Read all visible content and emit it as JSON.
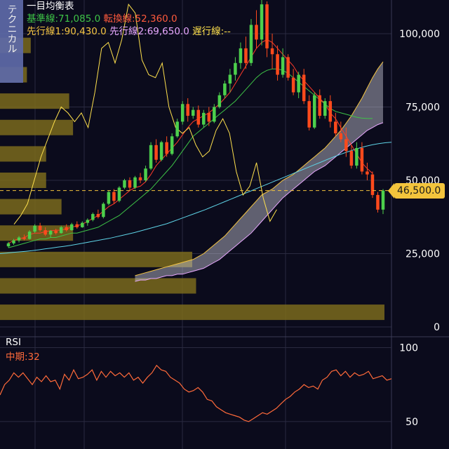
{
  "sidebar_tab": {
    "label": "テクニカル"
  },
  "legend": {
    "title": "一目均衡表",
    "kijun": "基準線:71,085.0",
    "tenkan": "転換線:52,360.0",
    "span1": "先行線1:90,430.0",
    "span2": "先行線2:69,650.0",
    "chikou": "遅行線:--"
  },
  "price_label": "46,500.0",
  "rsi": {
    "title": "RSI",
    "mid": "中期:32"
  },
  "colors": {
    "background": "#0b0b1c",
    "up": "#4cd04c",
    "down": "#ff4a1c",
    "kijun": "#3ec447",
    "tenkan": "#ff3a2a",
    "span1": "#f5c542",
    "span2": "#e9a8ff",
    "chikou": "#ffe14d",
    "sma": "#5ed3e6",
    "rsi": "#ff6a3a",
    "volume_profile": "#7a6a1c"
  },
  "chart_data": [
    {
      "type": "candlestick",
      "title": "一目均衡表",
      "ylim": [
        0,
        112000
      ],
      "y_ticks": [
        {
          "value": 0,
          "label": "0"
        },
        {
          "value": 25000,
          "label": "25,000"
        },
        {
          "value": 50000,
          "label": "50,000"
        },
        {
          "value": 75000,
          "label": "75,000"
        },
        {
          "value": 100000,
          "label": "100,000"
        }
      ],
      "current_price": 46500,
      "grid": true,
      "candles": [
        [
          27500,
          29000,
          27000,
          28500
        ],
        [
          28500,
          30000,
          28000,
          29500
        ],
        [
          29500,
          31000,
          28800,
          30500
        ],
        [
          30500,
          31500,
          29500,
          30000
        ],
        [
          30000,
          33000,
          29800,
          32500
        ],
        [
          32500,
          35000,
          32000,
          34500
        ],
        [
          34500,
          35500,
          32500,
          33000
        ],
        [
          33000,
          34000,
          31000,
          31500
        ],
        [
          31500,
          33000,
          30500,
          32800
        ],
        [
          32800,
          33500,
          31500,
          32000
        ],
        [
          32000,
          34500,
          31800,
          34000
        ],
        [
          34000,
          35000,
          32500,
          33000
        ],
        [
          33000,
          35500,
          32800,
          35000
        ],
        [
          35000,
          36000,
          33500,
          34000
        ],
        [
          34000,
          36000,
          33800,
          35500
        ],
        [
          35500,
          37000,
          34500,
          36500
        ],
        [
          36500,
          39000,
          36000,
          38500
        ],
        [
          38500,
          40000,
          37000,
          37500
        ],
        [
          37500,
          42500,
          37000,
          42000
        ],
        [
          42000,
          46500,
          41500,
          46000
        ],
        [
          46000,
          47000,
          42000,
          43000
        ],
        [
          43000,
          48000,
          42500,
          47500
        ],
        [
          47500,
          50500,
          47000,
          50000
        ],
        [
          50000,
          51000,
          46500,
          47500
        ],
        [
          47500,
          51500,
          47000,
          51000
        ],
        [
          51000,
          52500,
          49000,
          50000
        ],
        [
          50000,
          55000,
          49500,
          54000
        ],
        [
          54000,
          63000,
          53500,
          62000
        ],
        [
          62000,
          64000,
          56000,
          57000
        ],
        [
          57000,
          63500,
          56500,
          63000
        ],
        [
          63000,
          65000,
          58000,
          59000
        ],
        [
          59000,
          66000,
          58500,
          65000
        ],
        [
          65000,
          71000,
          64500,
          70000
        ],
        [
          70000,
          77000,
          69000,
          76000
        ],
        [
          76000,
          78000,
          70000,
          72000
        ],
        [
          72000,
          75000,
          71000,
          74000
        ],
        [
          74000,
          75500,
          68000,
          69000
        ],
        [
          69000,
          74000,
          68000,
          73000
        ],
        [
          73000,
          75000,
          68500,
          70000
        ],
        [
          70000,
          76000,
          69500,
          75000
        ],
        [
          75000,
          80000,
          74500,
          79000
        ],
        [
          79000,
          84000,
          78000,
          83000
        ],
        [
          83000,
          88000,
          80000,
          86000
        ],
        [
          86000,
          92000,
          84000,
          90000
        ],
        [
          90000,
          97000,
          88000,
          95000
        ],
        [
          95000,
          99000,
          88000,
          90000
        ],
        [
          90000,
          105000,
          89000,
          103000
        ],
        [
          103000,
          108000,
          95000,
          98000
        ],
        [
          98000,
          112000,
          96000,
          110000
        ],
        [
          110000,
          111000,
          92000,
          95000
        ],
        [
          95000,
          100000,
          88000,
          93000
        ],
        [
          93000,
          96000,
          84000,
          86000
        ],
        [
          86000,
          95000,
          85000,
          92000
        ],
        [
          92000,
          93000,
          84000,
          85000
        ],
        [
          85000,
          88000,
          79000,
          80000
        ],
        [
          80000,
          87000,
          78000,
          86000
        ],
        [
          86000,
          88000,
          76000,
          77000
        ],
        [
          77000,
          79000,
          67000,
          68000
        ],
        [
          68000,
          80000,
          67500,
          79000
        ],
        [
          79000,
          81000,
          71000,
          72000
        ],
        [
          72000,
          78000,
          71000,
          77000
        ],
        [
          77000,
          79000,
          68000,
          70000
        ],
        [
          70000,
          73000,
          65000,
          66000
        ],
        [
          66000,
          70000,
          63000,
          64000
        ],
        [
          64000,
          68000,
          58000,
          60000
        ],
        [
          60000,
          62000,
          54000,
          55000
        ],
        [
          55000,
          63000,
          54000,
          61000
        ],
        [
          61000,
          63000,
          52000,
          53000
        ],
        [
          53000,
          56000,
          50000,
          52000
        ],
        [
          52000,
          53000,
          44000,
          45000
        ],
        [
          45000,
          46000,
          39000,
          40000
        ],
        [
          40000,
          47000,
          38500,
          46500
        ]
      ],
      "tenkan": [
        28500,
        29500,
        30000,
        30500,
        31500,
        32000,
        32000,
        32500,
        32800,
        33000,
        33000,
        33500,
        34000,
        34500,
        35000,
        36000,
        37000,
        38000,
        39500,
        41000,
        42000,
        43500,
        45000,
        46500,
        47500,
        48000,
        49500,
        52000,
        55000,
        57000,
        59000,
        61000,
        63000,
        65500,
        68000,
        70000,
        71000,
        72000,
        73000,
        74500,
        76000,
        78000,
        80000,
        83000,
        86000,
        89000,
        92000,
        95000,
        97000,
        98000,
        97000,
        95000,
        93000,
        91000,
        89000,
        86000,
        84000,
        82000,
        80000,
        78000,
        76000,
        73000,
        71000,
        68000,
        65000,
        62000,
        59000,
        56000,
        54000,
        52360
      ],
      "kijun": [
        27000,
        27500,
        28000,
        28500,
        29000,
        29500,
        30000,
        30000,
        30500,
        30500,
        31000,
        31500,
        32000,
        32000,
        32500,
        33000,
        33500,
        34000,
        35000,
        36000,
        37000,
        38000,
        39500,
        41000,
        42500,
        44000,
        45500,
        47000,
        49000,
        51000,
        53000,
        55000,
        57500,
        60000,
        62500,
        65000,
        66500,
        68000,
        69500,
        71000,
        72500,
        74000,
        75500,
        77000,
        79000,
        81000,
        83000,
        85000,
        86500,
        87500,
        88000,
        88000,
        87500,
        86500,
        85000,
        83500,
        82000,
        80500,
        79000,
        77500,
        76000,
        74500,
        73500,
        73000,
        72500,
        72000,
        71500,
        71200,
        71085,
        71085
      ],
      "span1": [
        17500,
        18000,
        18500,
        19000,
        19500,
        20000,
        20500,
        21000,
        21500,
        22000,
        22500,
        23000,
        24000,
        25000,
        26500,
        28000,
        29500,
        31000,
        33000,
        35000,
        37000,
        39000,
        41000,
        43000,
        45000,
        46000,
        47000,
        48500,
        50000,
        51000,
        52000,
        53500,
        55000,
        56500,
        58000,
        59500,
        61000,
        63000,
        65000,
        67000,
        69500,
        72000,
        75000,
        78000,
        81500,
        85000,
        88000,
        90430
      ],
      "span2": [
        15500,
        16000,
        16000,
        16500,
        16500,
        17000,
        17500,
        17500,
        18000,
        18000,
        18500,
        19000,
        19500,
        20000,
        21000,
        22000,
        23000,
        24500,
        26000,
        27500,
        29000,
        30500,
        32000,
        34000,
        36000,
        38000,
        40000,
        42000,
        44000,
        45500,
        47000,
        48500,
        50000,
        51500,
        53000,
        54000,
        55000,
        56500,
        58000,
        59500,
        61000,
        62500,
        64000,
        65500,
        67000,
        68000,
        69000,
        69650
      ],
      "chikou": [
        35000,
        38000,
        42000,
        50000,
        58000,
        64000,
        70000,
        75000,
        73000,
        70000,
        73000,
        68000,
        80000,
        95000,
        97000,
        90000,
        98000,
        110000,
        107000,
        91000,
        86000,
        85000,
        90000,
        75000,
        68000,
        66000,
        68000,
        62000,
        58000,
        60000,
        67000,
        71000,
        66000,
        53000,
        45000,
        48000,
        56000,
        44000,
        36000,
        40000
      ],
      "sma": [
        25000,
        25200,
        25400,
        25600,
        25800,
        26000,
        26300,
        26600,
        26900,
        27200,
        27500,
        27800,
        28200,
        28600,
        29000,
        29400,
        29800,
        30200,
        30700,
        31200,
        31700,
        32200,
        32800,
        33400,
        34000,
        34600,
        35200,
        36000,
        36800,
        37600,
        38400,
        39200,
        40000,
        40900,
        41800,
        42700,
        43600,
        44500,
        45400,
        46300,
        47200,
        48100,
        49000,
        49900,
        50800,
        51700,
        52600,
        53500,
        54400,
        55300,
        56200,
        57100,
        58000,
        58800,
        59600,
        60300,
        61000,
        61600,
        62100,
        62500,
        62800,
        63000
      ],
      "volume_profile": [
        {
          "price": 96000,
          "strength": 0.08
        },
        {
          "price": 86000,
          "strength": 0.07
        },
        {
          "price": 77000,
          "strength": 0.18
        },
        {
          "price": 68000,
          "strength": 0.19
        },
        {
          "price": 59000,
          "strength": 0.12
        },
        {
          "price": 50000,
          "strength": 0.12
        },
        {
          "price": 41000,
          "strength": 0.16
        },
        {
          "price": 32000,
          "strength": 0.19
        },
        {
          "price": 23000,
          "strength": 0.5
        },
        {
          "price": 14000,
          "strength": 0.51
        },
        {
          "price": 5000,
          "strength": 1.0
        }
      ]
    },
    {
      "type": "line",
      "title": "RSI",
      "ylim": [
        40,
        105
      ],
      "y_ticks": [
        {
          "value": 100,
          "label": "100"
        },
        {
          "value": 50,
          "label": "50"
        }
      ],
      "values": [
        68,
        75,
        78,
        83,
        80,
        83,
        79,
        75,
        80,
        77,
        81,
        77,
        78,
        72,
        82,
        78,
        85,
        79,
        80,
        82,
        85,
        78,
        84,
        80,
        84,
        81,
        83,
        80,
        83,
        78,
        80,
        76,
        80,
        83,
        88,
        85,
        84,
        80,
        78,
        76,
        72,
        70,
        71,
        73,
        70,
        65,
        64,
        60,
        58,
        56,
        55,
        54,
        53,
        51,
        50,
        52,
        54,
        56,
        55,
        57,
        59,
        62,
        65,
        67,
        70,
        72,
        75,
        73,
        74,
        72,
        78,
        80,
        84,
        85,
        81,
        84,
        80,
        83,
        81,
        82,
        84,
        79,
        80,
        81,
        78,
        79
      ]
    }
  ]
}
